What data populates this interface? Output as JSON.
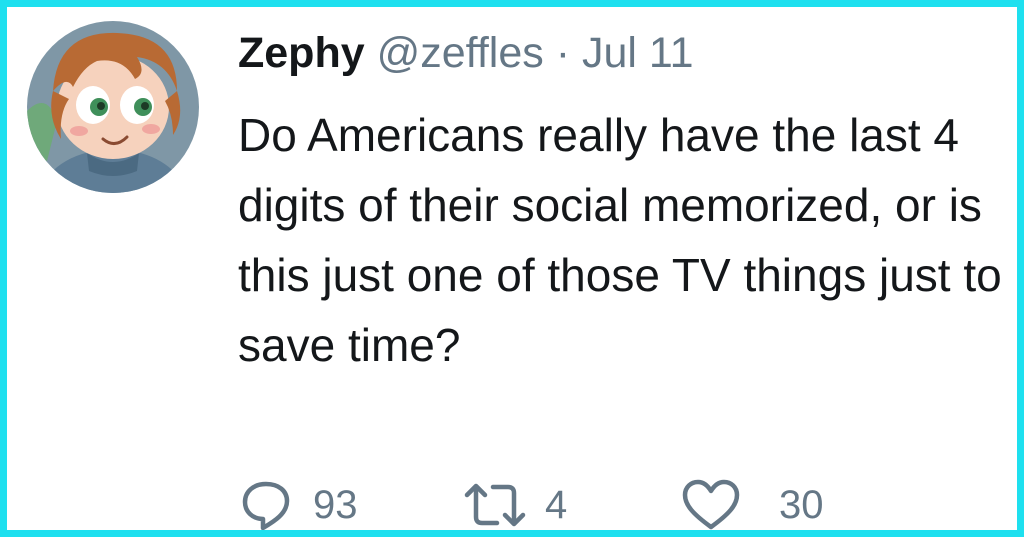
{
  "tweet": {
    "display_name": "Zephy",
    "handle": "@zeffles",
    "separator": "·",
    "date": "Jul 11",
    "text": "Do Americans really have the last 4 digits of their social memorized, or is this just one of those TV things just to save time?"
  },
  "actions": {
    "replies": "93",
    "retweets": "4",
    "likes": "30"
  },
  "icons": {
    "reply": "speech-bubble-icon",
    "retweet": "retweet-icon",
    "like": "heart-icon"
  },
  "colors": {
    "frame_border": "#1ee0ef",
    "text": "#14171a",
    "muted": "#657786"
  }
}
